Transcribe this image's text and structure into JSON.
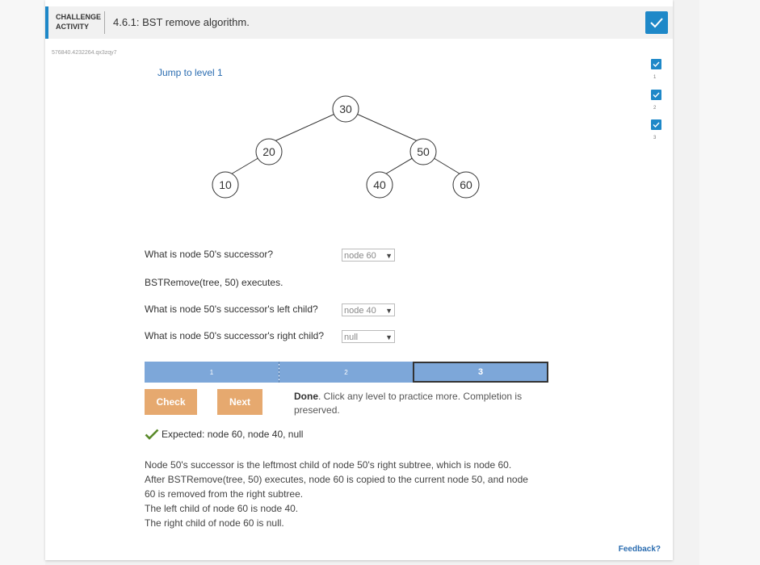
{
  "header": {
    "type_line1": "CHALLENGE",
    "type_line2": "ACTIVITY",
    "title": "4.6.1: BST remove algorithm."
  },
  "activity_id": "576840.4232264.qx3zqy7",
  "jump_label": "Jump to level 1",
  "tree": {
    "nodes": [
      {
        "key": "30",
        "label": "30"
      },
      {
        "key": "20",
        "label": "20"
      },
      {
        "key": "50",
        "label": "50"
      },
      {
        "key": "10",
        "label": "10"
      },
      {
        "key": "40",
        "label": "40"
      },
      {
        "key": "60",
        "label": "60"
      }
    ],
    "edges": [
      [
        "30",
        "20"
      ],
      [
        "30",
        "50"
      ],
      [
        "20",
        "10"
      ],
      [
        "50",
        "40"
      ],
      [
        "50",
        "60"
      ]
    ]
  },
  "questions": {
    "q1": {
      "text": "What is node 50's successor?",
      "selected": "node 60"
    },
    "statement": "BSTRemove(tree, 50) executes.",
    "q2": {
      "text": "What is node 50's successor's left child?",
      "selected": "node 40"
    },
    "q3": {
      "text": "What is node 50's successor's right child?",
      "selected": "null"
    }
  },
  "levels": {
    "labels": [
      "1",
      "2",
      "3"
    ],
    "active": "3"
  },
  "buttons": {
    "check": "Check",
    "next": "Next"
  },
  "done": {
    "bold": "Done",
    "rest": ". Click any level to practice more. Completion is preserved."
  },
  "expected": "Expected: node 60, node 40, null",
  "explanation": [
    "Node 50's successor is the leftmost child of node 50's right subtree, which is node 60.",
    "After BSTRemove(tree, 50) executes, node 60 is copied to the current node 50, and node",
    "60 is removed from the right subtree.",
    "The left child of node 60 is node 40.",
    "The right child of node 60 is null."
  ],
  "feedback": "Feedback?",
  "level_indicators": [
    "1",
    "2",
    "3"
  ],
  "colors": {
    "accent": "#1e88c8",
    "button": "#e6a96f",
    "level_bar": "#7da7d9",
    "check_green": "#5a8a2a"
  }
}
